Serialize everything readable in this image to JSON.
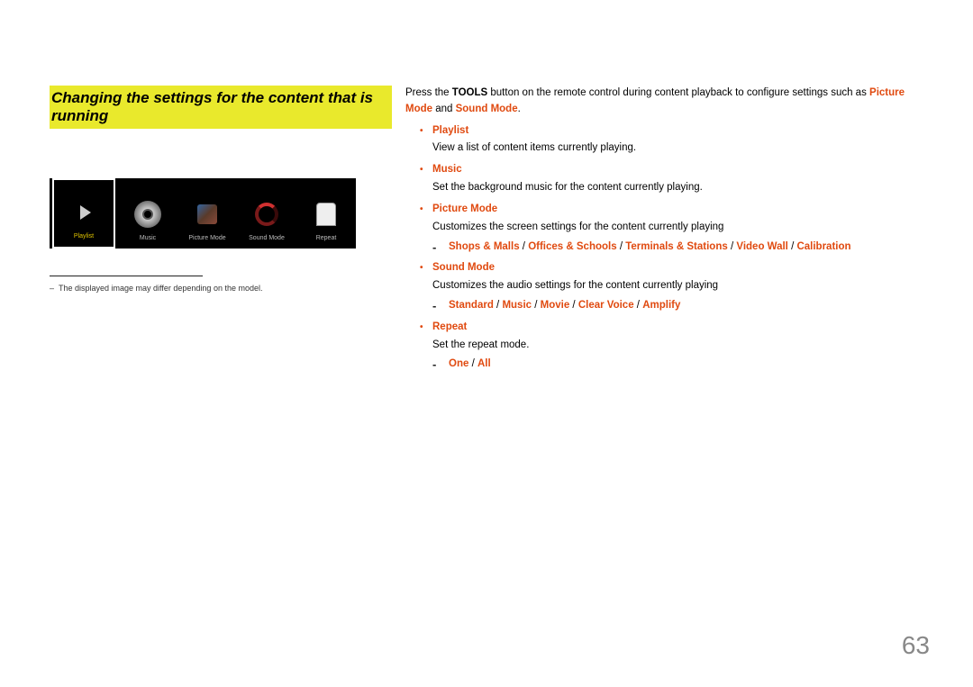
{
  "heading": "Changing the settings for the content that is running",
  "menu": {
    "items": [
      {
        "label": "Playlist"
      },
      {
        "label": "Music"
      },
      {
        "label": "Picture Mode"
      },
      {
        "label": "Sound Mode"
      },
      {
        "label": "Repeat"
      }
    ]
  },
  "footnote": "The displayed image may differ depending on the model.",
  "intro": {
    "pre": "Press the ",
    "tools": "TOOLS",
    "mid": " button on the remote control during content playback to configure settings such as ",
    "pm": "Picture Mode",
    "and": " and ",
    "sm": "Sound Mode",
    "period": "."
  },
  "items": {
    "playlist": {
      "title": "Playlist",
      "desc": "View a list of content items currently playing."
    },
    "music": {
      "title": "Music",
      "desc": "Set the background music for the content currently playing."
    },
    "picture_mode": {
      "title": "Picture Mode",
      "desc": "Customizes the screen settings for the content currently playing",
      "opts": [
        "Shops & Malls",
        "Offices & Schools",
        "Terminals & Stations",
        "Video Wall",
        "Calibration"
      ]
    },
    "sound_mode": {
      "title": "Sound Mode",
      "desc": "Customizes the audio settings for the content currently playing",
      "opts": [
        "Standard",
        "Music",
        "Movie",
        "Clear Voice",
        "Amplify"
      ]
    },
    "repeat": {
      "title": "Repeat",
      "desc": "Set the repeat mode.",
      "opts": [
        "One",
        "All"
      ]
    }
  },
  "page_number": "63"
}
